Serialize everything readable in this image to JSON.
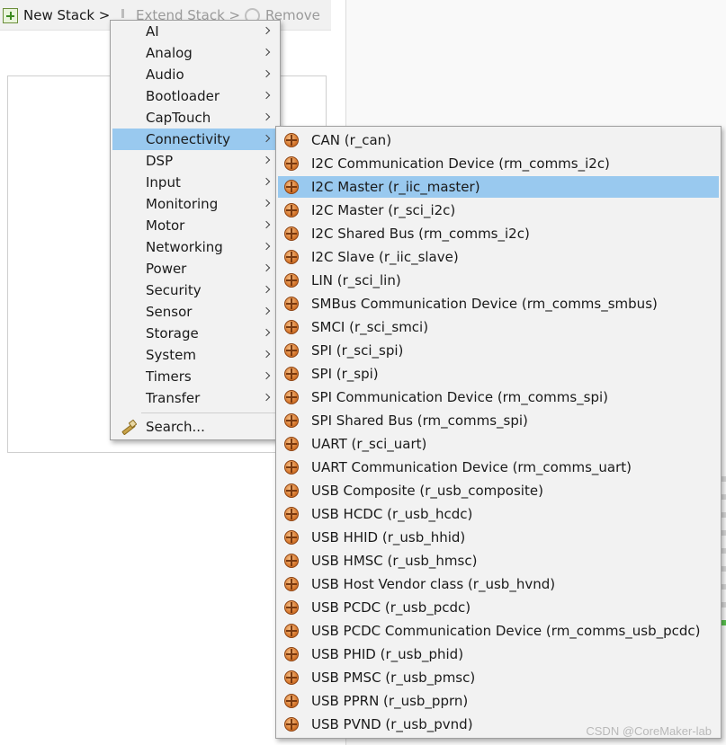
{
  "toolbar": {
    "new_stack": "New Stack >",
    "extend_stack": "Extend Stack >",
    "remove": "Remove"
  },
  "main_menu": {
    "items": [
      {
        "label": "AI",
        "active": false
      },
      {
        "label": "Analog",
        "active": false
      },
      {
        "label": "Audio",
        "active": false
      },
      {
        "label": "Bootloader",
        "active": false
      },
      {
        "label": "CapTouch",
        "active": false
      },
      {
        "label": "Connectivity",
        "active": true
      },
      {
        "label": "DSP",
        "active": false
      },
      {
        "label": "Input",
        "active": false
      },
      {
        "label": "Monitoring",
        "active": false
      },
      {
        "label": "Motor",
        "active": false
      },
      {
        "label": "Networking",
        "active": false
      },
      {
        "label": "Power",
        "active": false
      },
      {
        "label": "Security",
        "active": false
      },
      {
        "label": "Sensor",
        "active": false
      },
      {
        "label": "Storage",
        "active": false
      },
      {
        "label": "System",
        "active": false
      },
      {
        "label": "Timers",
        "active": false
      },
      {
        "label": "Transfer",
        "active": false
      }
    ],
    "search_label": "Search..."
  },
  "sub_menu": {
    "items": [
      {
        "label": "CAN (r_can)",
        "active": false
      },
      {
        "label": "I2C Communication Device (rm_comms_i2c)",
        "active": false
      },
      {
        "label": "I2C Master (r_iic_master)",
        "active": true
      },
      {
        "label": "I2C Master (r_sci_i2c)",
        "active": false
      },
      {
        "label": "I2C Shared Bus (rm_comms_i2c)",
        "active": false
      },
      {
        "label": "I2C Slave (r_iic_slave)",
        "active": false
      },
      {
        "label": "LIN (r_sci_lin)",
        "active": false
      },
      {
        "label": "SMBus Communication Device (rm_comms_smbus)",
        "active": false
      },
      {
        "label": "SMCI (r_sci_smci)",
        "active": false
      },
      {
        "label": "SPI (r_sci_spi)",
        "active": false
      },
      {
        "label": "SPI (r_spi)",
        "active": false
      },
      {
        "label": "SPI Communication Device (rm_comms_spi)",
        "active": false
      },
      {
        "label": "SPI Shared Bus (rm_comms_spi)",
        "active": false
      },
      {
        "label": "UART (r_sci_uart)",
        "active": false
      },
      {
        "label": "UART Communication Device (rm_comms_uart)",
        "active": false
      },
      {
        "label": "USB Composite (r_usb_composite)",
        "active": false
      },
      {
        "label": "USB HCDC (r_usb_hcdc)",
        "active": false
      },
      {
        "label": "USB HHID (r_usb_hhid)",
        "active": false
      },
      {
        "label": "USB HMSC (r_usb_hmsc)",
        "active": false
      },
      {
        "label": "USB Host Vendor class (r_usb_hvnd)",
        "active": false
      },
      {
        "label": "USB PCDC (r_usb_pcdc)",
        "active": false
      },
      {
        "label": "USB PCDC Communication Device (rm_comms_usb_pcdc)",
        "active": false
      },
      {
        "label": "USB PHID (r_usb_phid)",
        "active": false
      },
      {
        "label": "USB PMSC (r_usb_pmsc)",
        "active": false
      },
      {
        "label": "USB PPRN (r_usb_pprn)",
        "active": false
      },
      {
        "label": "USB PVND (r_usb_pvnd)",
        "active": false
      }
    ]
  },
  "watermark": "CSDN @CoreMaker-lab",
  "colors": {
    "highlight": "#99c9ef",
    "menu_bg": "#f2f2f2"
  }
}
